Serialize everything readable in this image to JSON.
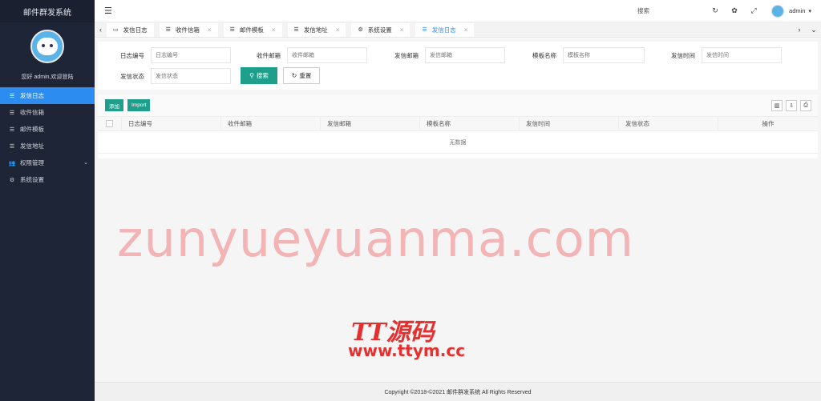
{
  "sidebar": {
    "app_title": "邮件群发系统",
    "welcome": "您好 admin,欢迎登陆",
    "items": [
      {
        "label": "发信日志",
        "icon": "list-icon",
        "glyph": "☰",
        "active": true
      },
      {
        "label": "收件信箱",
        "icon": "list-icon",
        "glyph": "☰"
      },
      {
        "label": "邮件模板",
        "icon": "list-icon",
        "glyph": "☰"
      },
      {
        "label": "发信地址",
        "icon": "list-icon",
        "glyph": "☰"
      },
      {
        "label": "权限管理",
        "icon": "users-icon",
        "glyph": "👥",
        "has_children": true
      },
      {
        "label": "系统设置",
        "icon": "gear-icon",
        "glyph": "⚙"
      }
    ]
  },
  "topbar": {
    "search_label": "搜索",
    "username": "admin"
  },
  "tabs": [
    {
      "label": "发信日志",
      "icon": "monitor-icon",
      "glyph": "▭",
      "closable": false
    },
    {
      "label": "收件信箱",
      "icon": "list-icon",
      "glyph": "☰",
      "closable": true
    },
    {
      "label": "邮件模板",
      "icon": "list-icon",
      "glyph": "☰",
      "closable": true
    },
    {
      "label": "发信地址",
      "icon": "list-icon",
      "glyph": "☰",
      "closable": true
    },
    {
      "label": "系统设置",
      "icon": "gear-icon",
      "glyph": "⚙",
      "closable": true
    },
    {
      "label": "发信日志",
      "icon": "list-icon",
      "glyph": "☰",
      "closable": true,
      "active": true
    }
  ],
  "search_form": {
    "fields": [
      {
        "label": "日志编号",
        "placeholder": "日志编号"
      },
      {
        "label": "收件邮箱",
        "placeholder": "收件邮箱"
      },
      {
        "label": "发信邮箱",
        "placeholder": "发信邮箱"
      },
      {
        "label": "模板名称",
        "placeholder": "模板名称"
      },
      {
        "label": "发信时间",
        "placeholder": "发信时间"
      },
      {
        "label": "发信状态",
        "placeholder": "发信状态"
      }
    ],
    "search_button": "搜索",
    "reset_button": "重置"
  },
  "toolbar": {
    "add_label": "添加",
    "import_label": "Import"
  },
  "table": {
    "columns": [
      "日志编号",
      "收件邮箱",
      "发信邮箱",
      "模板名称",
      "发信时间",
      "发信状态",
      "操作"
    ],
    "empty_text": "无数据"
  },
  "watermark": {
    "text": "zunyueyuanma.com",
    "logo_text": "TT源码",
    "url_text": "www.ttym.cc"
  },
  "footer": {
    "copyright": "Copyright ©2018-©2021 邮件群发系统 All Rights Reserved"
  },
  "colors": {
    "sidebar_bg": "#1e2536",
    "accent": "#2d8cf0",
    "primary_button": "#1e9f8c",
    "watermark": "#f2b4b4",
    "brand_red": "#e63030"
  }
}
